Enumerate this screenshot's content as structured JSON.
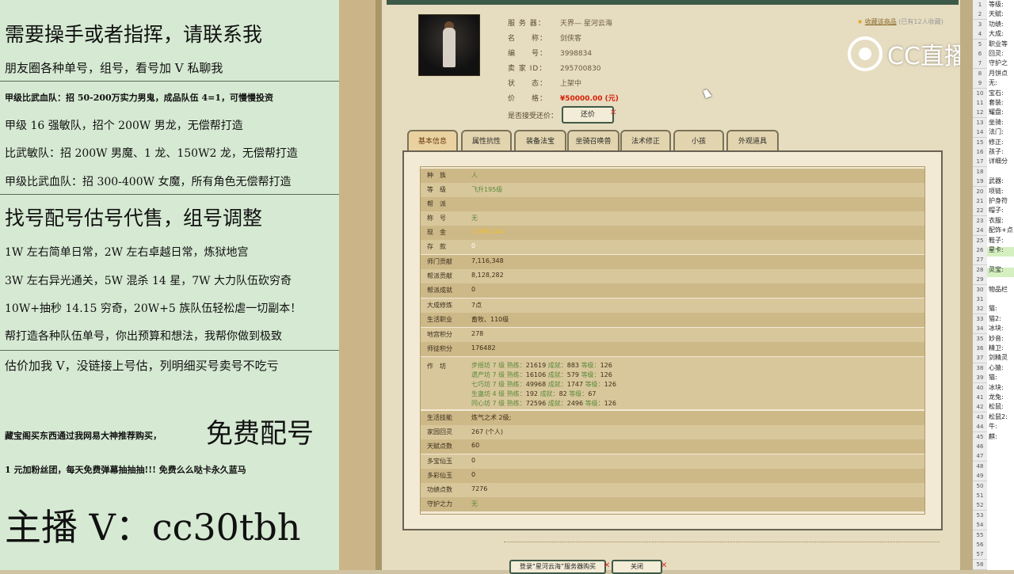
{
  "promo": {
    "line1": "需要操手或者指挥，请联系我",
    "line2": "朋友圈各种单号，组号，看号加 V 私聊我",
    "line3": "甲级比武血队：招 50-200万实力男鬼，成品队伍 4=1，可慢慢投资",
    "line4": "甲级 16 强敏队，招个 200W 男龙，无偿帮打造",
    "line5": "比武敏队：招 200W 男魔、1 龙、150W2 龙，无偿帮打造",
    "line6": "甲级比武血队：招 300-400W 女魔，所有角色无偿帮打造",
    "line7": "找号配号估号代售，组号调整",
    "line8": "1W 左右简单日常，2W 左右卓越日常，炼狱地宫",
    "line9": "3W 左右异光通关，5W 混杀 14 星，7W 大力队伍砍穷奇",
    "line10": "10W+抽秒 14.15 穷奇，20W+5 族队伍轻松虐一切副本！",
    "line11": "帮打造各种队伍单号，你出预算和想法，我帮你做到极致",
    "line12": "估价加我 V，没链接上号估，列明细买号卖号不吃亏",
    "line13a": "藏宝阁买东西通过我网易大神推荐购买，",
    "line13b": "免费配号",
    "line14": "1 元加粉丝团，每天免费弹幕抽抽抽!!! 免费么么哒卡永久蓝马",
    "line15": "主播 V：cc30tbh"
  },
  "info": {
    "server_label": "服 务 器：",
    "server": "天界— 星河云海",
    "name_label": "名　　称：",
    "name": "剑侠客",
    "id_label": "编　　号：",
    "id": "3998834",
    "seller_label": "卖 家 ID：",
    "seller": "295700830",
    "status_label": "状　　态：",
    "status": "上架中",
    "price_label": "价　　格：",
    "price": "¥50000.00 (元)",
    "offer_label": "是否接受还价：",
    "offer_button": "还价"
  },
  "fav": {
    "link": "收藏该商品",
    "count": "(已有12人收藏)"
  },
  "tabs": [
    "基本信息",
    "属性抗性",
    "装备法宝",
    "坐骑召唤兽",
    "法术修正",
    "小孩",
    "外观道具"
  ],
  "basic": {
    "race_k": "种　族",
    "race_v": "人",
    "level_k": "等　级",
    "level_v": "飞升195级",
    "sect_k": "帮　派",
    "sect_v": "",
    "title_k": "称　号",
    "title_v": "无",
    "cash_k": "现　金",
    "cash_v": "1,988,344",
    "deposit_k": "存　款",
    "deposit_v": "0",
    "master_k": "师门贡献",
    "master_v": "7,116,348",
    "guild_contrib_k": "帮派贡献",
    "guild_contrib_v": "8,128,282",
    "guild_build_k": "帮派成就",
    "guild_build_v": "0",
    "cultivate_k": "大成修炼",
    "cultivate_v": "7点",
    "life_k": "生活职业",
    "life_v": "畜牧、110级",
    "dungeon_k": "地宫积分",
    "dungeon_v": "278",
    "mentor_k": "师徒积分",
    "mentor_v": "176482",
    "workshop_k": "作　坊",
    "ws1_a": "步摇坊 7 级",
    "ws1_b": "熟练：",
    "ws1_c": "21619",
    "ws1_d": "成就：",
    "ws1_e": "883",
    "ws1_f": "等级：",
    "ws1_g": "126",
    "ws2_a": "遗产坊 7 级",
    "ws2_b": "熟练：",
    "ws2_c": "16106",
    "ws2_d": "成就：",
    "ws2_e": "579",
    "ws2_f": "等级：",
    "ws2_g": "126",
    "ws3_a": "七巧坊 7 级",
    "ws3_b": "熟练：",
    "ws3_c": "49968",
    "ws3_d": "成就：",
    "ws3_e": "1747",
    "ws3_f": "等级：",
    "ws3_g": "126",
    "ws4_a": "生蛊坊 4 级",
    "ws4_b": "熟练：",
    "ws4_c": "192",
    "ws4_d": "成就：",
    "ws4_e": "82",
    "ws4_f": "等级：",
    "ws4_g": "67",
    "ws5_a": "同心坊 7 级",
    "ws5_b": "熟练：",
    "ws5_c": "72596",
    "ws5_d": "成就：",
    "ws5_e": "2496",
    "ws5_f": "等级：",
    "ws5_g": "126",
    "skill_k": "生活技能",
    "skill_v": "炼气之术 2级;",
    "home_k": "家园回灵",
    "home_v": "267 (个人)",
    "talent_k": "天赋点数",
    "talent_v": "60",
    "fairy1_k": "多宝仙玉",
    "fairy1_v": "0",
    "fairy2_k": "多彩仙玉",
    "fairy2_v": "0",
    "merit_k": "功绩点数",
    "merit_v": "7276",
    "guard_k": "守护之力",
    "guard_v": "无"
  },
  "bottom": {
    "register": "登录“星河云海”服务器购买",
    "close": "关闭"
  },
  "logo": "CC直播",
  "sheet": [
    {
      "n": "1",
      "t": "等级:"
    },
    {
      "n": "2",
      "t": "天赋:"
    },
    {
      "n": "3",
      "t": "功绩:"
    },
    {
      "n": "4",
      "t": "大成:"
    },
    {
      "n": "5",
      "t": "职业等"
    },
    {
      "n": "6",
      "t": "回灵:"
    },
    {
      "n": "7",
      "t": "守护之"
    },
    {
      "n": "8",
      "t": "月饼点"
    },
    {
      "n": "9",
      "t": "无:"
    },
    {
      "n": "10",
      "t": "宝石:"
    },
    {
      "n": "11",
      "t": "套装:"
    },
    {
      "n": "12",
      "t": "耀盘:"
    },
    {
      "n": "13",
      "t": "坐骑:"
    },
    {
      "n": "14",
      "t": "法门:"
    },
    {
      "n": "15",
      "t": "修正:"
    },
    {
      "n": "16",
      "t": "孩子:"
    },
    {
      "n": "17",
      "t": "详细分"
    },
    {
      "n": "18",
      "t": ""
    },
    {
      "n": "19",
      "t": "武器:"
    },
    {
      "n": "20",
      "t": "项链:"
    },
    {
      "n": "21",
      "t": "护身符"
    },
    {
      "n": "22",
      "t": "帽子:"
    },
    {
      "n": "23",
      "t": "衣服:"
    },
    {
      "n": "24",
      "t": "配饰+点"
    },
    {
      "n": "25",
      "t": "鞋子:"
    },
    {
      "n": "26",
      "t": "星卡:"
    },
    {
      "n": "27",
      "t": ""
    },
    {
      "n": "28",
      "t": "灵宝:"
    },
    {
      "n": "29",
      "t": ""
    },
    {
      "n": "30",
      "t": "物品栏"
    },
    {
      "n": "31",
      "t": ""
    },
    {
      "n": "32",
      "t": "猫:"
    },
    {
      "n": "33",
      "t": "猫2:"
    },
    {
      "n": "34",
      "t": "冰块:"
    },
    {
      "n": "35",
      "t": "妙音:"
    },
    {
      "n": "36",
      "t": "精卫:"
    },
    {
      "n": "37",
      "t": "剑精灵"
    },
    {
      "n": "38",
      "t": "心猿:"
    },
    {
      "n": "39",
      "t": "猫:"
    },
    {
      "n": "40",
      "t": "冰块:"
    },
    {
      "n": "41",
      "t": "龙兔:"
    },
    {
      "n": "42",
      "t": "松鼠:"
    },
    {
      "n": "43",
      "t": "松鼠2:"
    },
    {
      "n": "44",
      "t": "牛:"
    },
    {
      "n": "45",
      "t": "麒:"
    },
    {
      "n": "46",
      "t": ""
    },
    {
      "n": "47",
      "t": ""
    },
    {
      "n": "48",
      "t": ""
    },
    {
      "n": "49",
      "t": ""
    },
    {
      "n": "50",
      "t": ""
    },
    {
      "n": "51",
      "t": ""
    },
    {
      "n": "52",
      "t": ""
    },
    {
      "n": "53",
      "t": ""
    },
    {
      "n": "54",
      "t": ""
    },
    {
      "n": "55",
      "t": ""
    },
    {
      "n": "56",
      "t": ""
    },
    {
      "n": "57",
      "t": ""
    },
    {
      "n": "58",
      "t": ""
    }
  ]
}
